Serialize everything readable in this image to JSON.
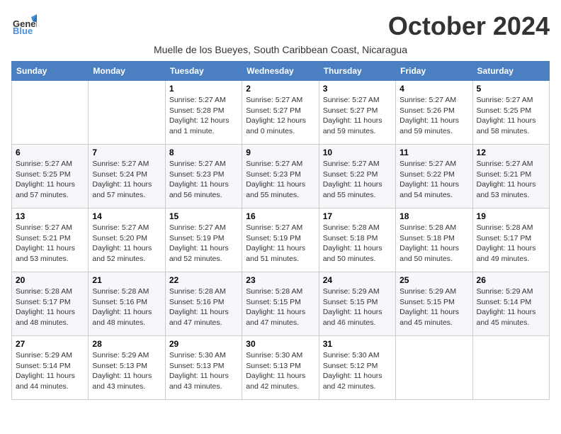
{
  "logo": {
    "general": "General",
    "blue": "Blue"
  },
  "title": "October 2024",
  "location": "Muelle de los Bueyes, South Caribbean Coast, Nicaragua",
  "weekdays": [
    "Sunday",
    "Monday",
    "Tuesday",
    "Wednesday",
    "Thursday",
    "Friday",
    "Saturday"
  ],
  "weeks": [
    [
      null,
      null,
      {
        "day": 1,
        "sunrise": "5:27 AM",
        "sunset": "5:28 PM",
        "daylight": "12 hours and 1 minute."
      },
      {
        "day": 2,
        "sunrise": "5:27 AM",
        "sunset": "5:27 PM",
        "daylight": "12 hours and 0 minutes."
      },
      {
        "day": 3,
        "sunrise": "5:27 AM",
        "sunset": "5:27 PM",
        "daylight": "11 hours and 59 minutes."
      },
      {
        "day": 4,
        "sunrise": "5:27 AM",
        "sunset": "5:26 PM",
        "daylight": "11 hours and 59 minutes."
      },
      {
        "day": 5,
        "sunrise": "5:27 AM",
        "sunset": "5:25 PM",
        "daylight": "11 hours and 58 minutes."
      }
    ],
    [
      {
        "day": 6,
        "sunrise": "5:27 AM",
        "sunset": "5:25 PM",
        "daylight": "11 hours and 57 minutes."
      },
      {
        "day": 7,
        "sunrise": "5:27 AM",
        "sunset": "5:24 PM",
        "daylight": "11 hours and 57 minutes."
      },
      {
        "day": 8,
        "sunrise": "5:27 AM",
        "sunset": "5:23 PM",
        "daylight": "11 hours and 56 minutes."
      },
      {
        "day": 9,
        "sunrise": "5:27 AM",
        "sunset": "5:23 PM",
        "daylight": "11 hours and 55 minutes."
      },
      {
        "day": 10,
        "sunrise": "5:27 AM",
        "sunset": "5:22 PM",
        "daylight": "11 hours and 55 minutes."
      },
      {
        "day": 11,
        "sunrise": "5:27 AM",
        "sunset": "5:22 PM",
        "daylight": "11 hours and 54 minutes."
      },
      {
        "day": 12,
        "sunrise": "5:27 AM",
        "sunset": "5:21 PM",
        "daylight": "11 hours and 53 minutes."
      }
    ],
    [
      {
        "day": 13,
        "sunrise": "5:27 AM",
        "sunset": "5:21 PM",
        "daylight": "11 hours and 53 minutes."
      },
      {
        "day": 14,
        "sunrise": "5:27 AM",
        "sunset": "5:20 PM",
        "daylight": "11 hours and 52 minutes."
      },
      {
        "day": 15,
        "sunrise": "5:27 AM",
        "sunset": "5:19 PM",
        "daylight": "11 hours and 52 minutes."
      },
      {
        "day": 16,
        "sunrise": "5:27 AM",
        "sunset": "5:19 PM",
        "daylight": "11 hours and 51 minutes."
      },
      {
        "day": 17,
        "sunrise": "5:28 AM",
        "sunset": "5:18 PM",
        "daylight": "11 hours and 50 minutes."
      },
      {
        "day": 18,
        "sunrise": "5:28 AM",
        "sunset": "5:18 PM",
        "daylight": "11 hours and 50 minutes."
      },
      {
        "day": 19,
        "sunrise": "5:28 AM",
        "sunset": "5:17 PM",
        "daylight": "11 hours and 49 minutes."
      }
    ],
    [
      {
        "day": 20,
        "sunrise": "5:28 AM",
        "sunset": "5:17 PM",
        "daylight": "11 hours and 48 minutes."
      },
      {
        "day": 21,
        "sunrise": "5:28 AM",
        "sunset": "5:16 PM",
        "daylight": "11 hours and 48 minutes."
      },
      {
        "day": 22,
        "sunrise": "5:28 AM",
        "sunset": "5:16 PM",
        "daylight": "11 hours and 47 minutes."
      },
      {
        "day": 23,
        "sunrise": "5:28 AM",
        "sunset": "5:15 PM",
        "daylight": "11 hours and 47 minutes."
      },
      {
        "day": 24,
        "sunrise": "5:29 AM",
        "sunset": "5:15 PM",
        "daylight": "11 hours and 46 minutes."
      },
      {
        "day": 25,
        "sunrise": "5:29 AM",
        "sunset": "5:15 PM",
        "daylight": "11 hours and 45 minutes."
      },
      {
        "day": 26,
        "sunrise": "5:29 AM",
        "sunset": "5:14 PM",
        "daylight": "11 hours and 45 minutes."
      }
    ],
    [
      {
        "day": 27,
        "sunrise": "5:29 AM",
        "sunset": "5:14 PM",
        "daylight": "11 hours and 44 minutes."
      },
      {
        "day": 28,
        "sunrise": "5:29 AM",
        "sunset": "5:13 PM",
        "daylight": "11 hours and 43 minutes."
      },
      {
        "day": 29,
        "sunrise": "5:30 AM",
        "sunset": "5:13 PM",
        "daylight": "11 hours and 43 minutes."
      },
      {
        "day": 30,
        "sunrise": "5:30 AM",
        "sunset": "5:13 PM",
        "daylight": "11 hours and 42 minutes."
      },
      {
        "day": 31,
        "sunrise": "5:30 AM",
        "sunset": "5:12 PM",
        "daylight": "11 hours and 42 minutes."
      },
      null,
      null
    ]
  ]
}
